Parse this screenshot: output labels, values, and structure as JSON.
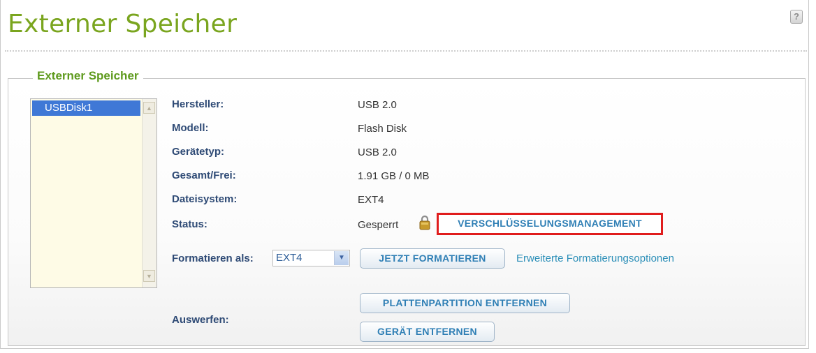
{
  "page": {
    "title": "Externer Speicher",
    "help_icon": "?"
  },
  "section": {
    "legend": "Externer Speicher"
  },
  "device_list": {
    "items": [
      "USBDisk1"
    ],
    "selected": "USBDisk1"
  },
  "details": {
    "manufacturer_label": "Hersteller:",
    "manufacturer_value": "USB 2.0",
    "model_label": "Modell:",
    "model_value": "Flash Disk",
    "device_type_label": "Gerätetyp:",
    "device_type_value": "USB 2.0",
    "capacity_label": "Gesamt/Frei:",
    "capacity_value": "1.91 GB / 0 MB",
    "filesystem_label": "Dateisystem:",
    "filesystem_value": "EXT4",
    "status_label": "Status:",
    "status_value": "Gesperrt"
  },
  "buttons": {
    "encryption_management": "VERSCHLÜSSELUNGSMANAGEMENT",
    "format_now": "JETZT FORMATIEREN",
    "remove_partition": "PLATTENPARTITION ENTFERNEN",
    "remove_device": "GERÄT ENTFERNEN"
  },
  "format": {
    "label": "Formatieren als:",
    "selected_value": "EXT4",
    "advanced_link": "Erweiterte Formatierungsoptionen"
  },
  "eject": {
    "label": "Auswerfen:"
  },
  "colors": {
    "accent": "#7aa51f",
    "label_text": "#2e4a75",
    "link": "#2c8fb8",
    "highlight_border": "#e01d1d"
  },
  "icons": {
    "help": "help-icon",
    "lock": "lock-icon",
    "dropdown": "chevron-down-icon"
  }
}
